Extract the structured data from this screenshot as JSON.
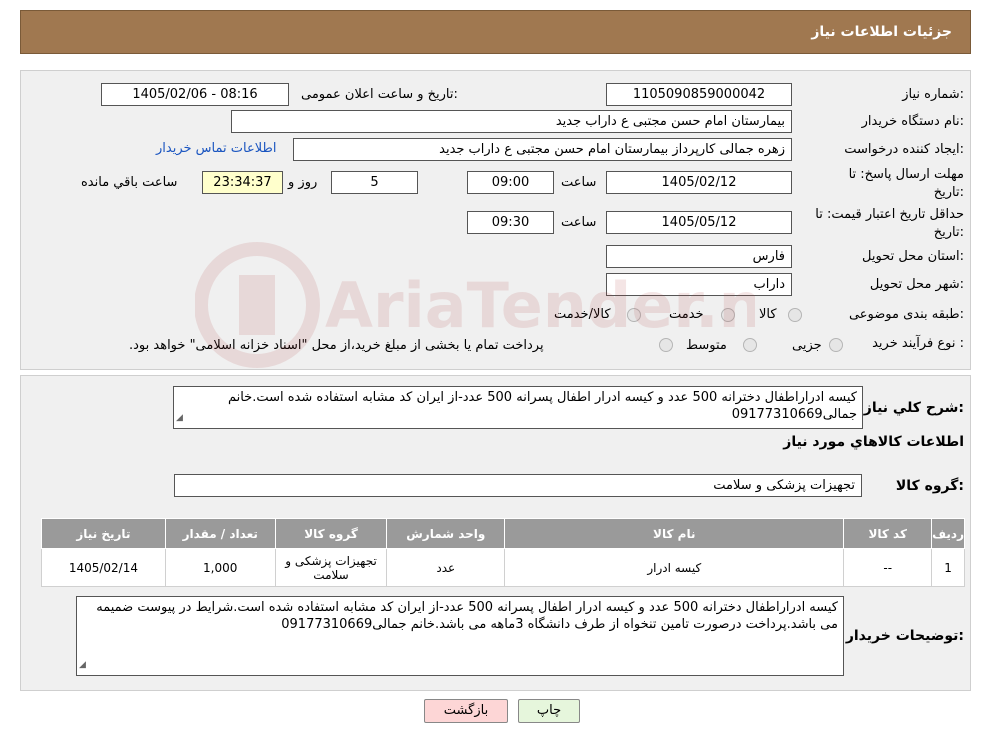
{
  "header": {
    "title": "جزئیات اطلاعات نیاز"
  },
  "form": {
    "need_number_label": "شماره نیاز:",
    "need_number": "1105090859000042",
    "announce_label": "تاریخ و ساعت اعلان عمومی:",
    "announce_value": "1405/02/06 - 08:16",
    "buyer_label": "نام دستگاه خریدار:",
    "buyer_value": "بیمارستان امام حسن مجتبی  ع  داراب جدید",
    "creator_label": "ایجاد کننده درخواست:",
    "creator_value": "زهره جمالی کارپرداز بیمارستان امام حسن مجتبی  ع  داراب جدید",
    "contact_link": "اطلاعات تماس خریدار",
    "reply_deadline_label": "مهلت ارسال پاسخ: تا تاریخ:",
    "reply_date": "1405/02/12",
    "time_label": "ساعت",
    "reply_time": "09:00",
    "days_value": "5",
    "days_label": "روز و",
    "countdown": "23:34:37",
    "remaining_label": "ساعت باقي مانده",
    "validity_label": "حداقل تاریخ اعتبار قیمت: تا تاریخ:",
    "validity_date": "1405/05/12",
    "validity_time": "09:30",
    "province_label": "استان محل تحویل:",
    "province_value": "فارس",
    "city_label": "شهر محل تحویل:",
    "city_value": "داراب",
    "category_label": "طبقه بندی موضوعی:",
    "cat_goods": "کالا",
    "cat_service": "خدمت",
    "cat_goods_service": "کالا/خدمت",
    "process_label": "نوع فرآیند خرید :",
    "proc_minor": "جزیی",
    "proc_medium": "متوسط",
    "payment_note": "پرداخت تمام یا بخشی از مبلغ خرید،از محل \"اسناد خزانه اسلامی\" خواهد بود."
  },
  "details": {
    "summary_label": "شرح کلي نياز:",
    "summary_text": "کیسه ادراراطفال دخترانه 500 عدد و کیسه ادرار اطفال پسرانه 500 عدد-از ایران کد مشابه استفاده شده است.خانم جمالی09177310669",
    "goods_info_title": "اطلاعات کالاهاي مورد نياز",
    "group_label": "گروه کالا:",
    "group_value": "تجهیزات پزشکی و سلامت",
    "table": {
      "headers": [
        "رديف",
        "کد کالا",
        "نام کالا",
        "واحد شمارش",
        "گروه کالا",
        "تعداد / مقدار",
        "تاريخ نياز"
      ],
      "rows": [
        [
          "1",
          "--",
          "کیسه ادرار",
          "عدد",
          "تجهیزات پزشکی و سلامت",
          "1,000",
          "1405/02/14"
        ]
      ]
    },
    "buyer_notes_label": "توضیحات خریدار:",
    "buyer_notes_text": "کیسه ادراراطفال دخترانه 500 عدد و کیسه ادرار اطفال پسرانه 500 عدد-از ایران کد مشابه استفاده شده است.شرایط در پیوست ضمیمه می باشد.پرداخت درصورت تامین تنخواه از طرف دانشگاه 3ماهه می باشد.خانم جمالی09177310669"
  },
  "buttons": {
    "print": "چاپ",
    "back": "بازگشت"
  },
  "watermark": {
    "text": "AriaTender.neT",
    "color": "#b04040"
  }
}
